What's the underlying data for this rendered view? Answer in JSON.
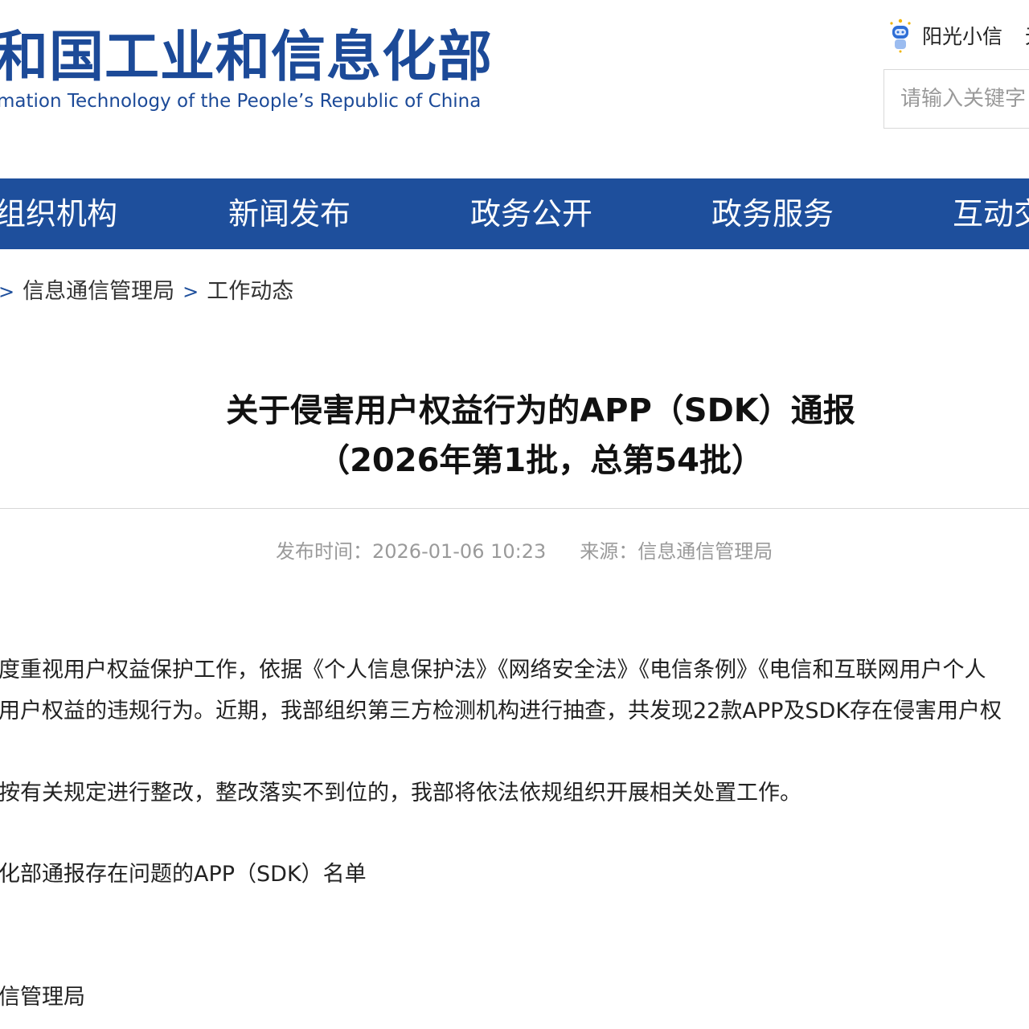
{
  "header": {
    "logo_cn": "和国工业和信息化部",
    "logo_en": "mation Technology of the People’s Republic of China",
    "assistant_label": "阳光小信",
    "assistant_extra": "无",
    "search_placeholder": "请输入关键字",
    "brand_color": "#1e4f9c"
  },
  "nav": {
    "items": [
      {
        "label": "组织机构"
      },
      {
        "label": "新闻发布"
      },
      {
        "label": "政务公开"
      },
      {
        "label": "政务服务"
      },
      {
        "label": "互动交"
      }
    ]
  },
  "breadcrumb": {
    "items": [
      {
        "label": "信息通信管理局"
      },
      {
        "label": "工作动态"
      }
    ],
    "separator": ">"
  },
  "article": {
    "title_line1": "关于侵害用户权益行为的APP（SDK）通报",
    "title_line2": "（2026年第1批，总第54批）",
    "publish_time": "发布时间：2026-01-06 10:23",
    "source": "来源：信息通信管理局",
    "paragraphs": [
      "度重视用户权益保护工作，依据《个人信息保护法》《网络安全法》《电信条例》《电信和互联网用户个人",
      "用户权益的违规行为。近期，我部组织第三方检测机构进行抽查，共发现22款APP及SDK存在侵害用户权",
      "按有关规定进行整改，整改落实不到位的，我部将依法依规组织开展相关处置工作。",
      "化部通报存在问题的APP（SDK）名单",
      "信管理局"
    ]
  },
  "icons": {
    "assistant": "robot-icon"
  }
}
